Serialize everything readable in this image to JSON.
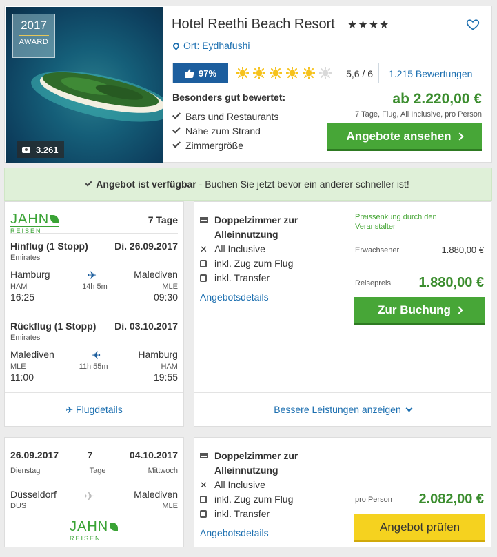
{
  "hotel": {
    "award_year": "2017",
    "award_label": "AWARD",
    "photo_count": "3.261",
    "name": "Hotel Reethi Beach Resort",
    "stars": "★★★★",
    "location": "Ort: Eydhafushi",
    "recommend_pct": "97%",
    "sun_rating": "5,6 / 6",
    "reviews": "1.215 Bewertungen",
    "rated_heading": "Besonders gut bewertet:",
    "rated_items": [
      "Bars und Restaurants",
      "Nähe zum Strand",
      "Zimmergröße"
    ],
    "price_from": "ab 2.220,00 €",
    "price_note": "7 Tage, Flug, All Inclusive, pro Person",
    "cta_label": "Angebote ansehen"
  },
  "availability": {
    "bold": "Angebot ist verfügbar",
    "rest": " - Buchen Sie jetzt bevor ein anderer schneller ist!"
  },
  "offer1": {
    "operator_main": "JAHN",
    "operator_sub": "REISEN",
    "duration": "7 Tage",
    "outbound": {
      "title": "Hinflug (1 Stopp)",
      "date": "Di. 26.09.2017",
      "airline": "Emirates",
      "from_city": "Hamburg",
      "from_code": "HAM",
      "dep_time": "16:25",
      "flight_time": "14h 5m",
      "to_city": "Malediven",
      "to_code": "MLE",
      "arr_time": "09:30"
    },
    "inbound": {
      "title": "Rückflug (1 Stopp)",
      "date": "Di. 03.10.2017",
      "airline": "Emirates",
      "from_city": "Malediven",
      "from_code": "MLE",
      "dep_time": "11:00",
      "flight_time": "11h 55m",
      "to_city": "Hamburg",
      "to_code": "HAM",
      "arr_time": "19:55"
    },
    "room": "Doppelzimmer zur Alleinnutzung",
    "board": "All Inclusive",
    "train": "inkl. Zug zum Flug",
    "transfer": "inkl. Transfer",
    "details_link": "Angebotsdetails",
    "price_drop": "Preissenkung durch den Veranstalter",
    "adult_label": "Erwachsener",
    "adult_price": "1.880,00 €",
    "travel_price_label": "Reisepreis",
    "travel_price": "1.880,00 €",
    "book_label": "Zur Buchung",
    "flight_details": "Flugdetails",
    "better_services": "Bessere Leistungen anzeigen"
  },
  "offer2": {
    "start_date": "26.09.2017",
    "start_day": "Dienstag",
    "nights": "7",
    "nights_label": "Tage",
    "end_date": "04.10.2017",
    "end_day": "Mittwoch",
    "from_city": "Düsseldorf",
    "from_code": "DUS",
    "to_city": "Malediven",
    "to_code": "MLE",
    "operator_main": "JAHN",
    "operator_sub": "REISEN",
    "room": "Doppelzimmer zur Alleinnutzung",
    "board": "All Inclusive",
    "train": "inkl. Zug zum Flug",
    "transfer": "inkl. Transfer",
    "details_link": "Angebotsdetails",
    "per_person_label": "pro Person",
    "price": "2.082,00 €",
    "check_label": "Angebot prüfen"
  },
  "colors": {
    "accent_blue": "#1c6fb0",
    "price_green": "#3b8d2e",
    "button_green": "#47a637",
    "button_yellow": "#f5d21f",
    "banner_green": "#dff0d8"
  },
  "rating": {
    "suns_filled": 5,
    "suns_total": 6
  }
}
